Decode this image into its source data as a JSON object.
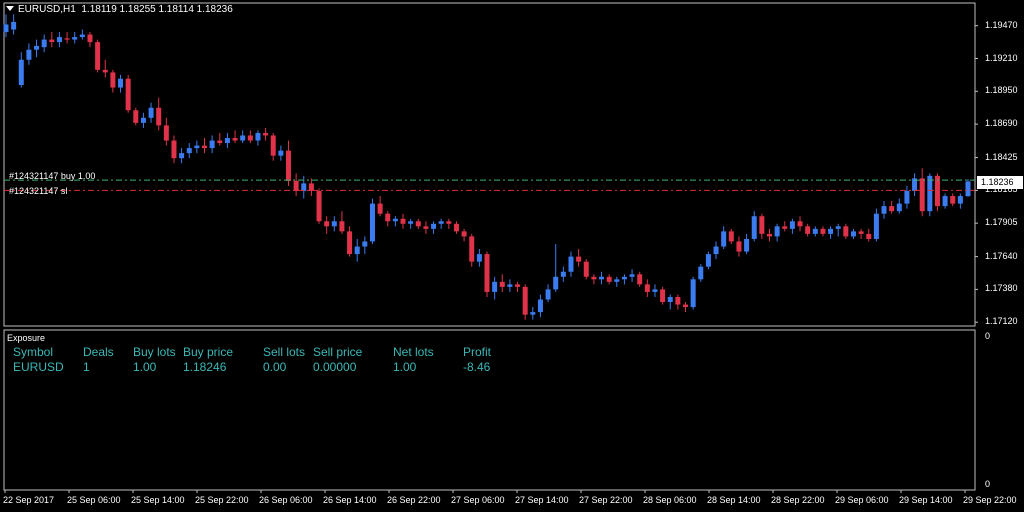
{
  "header": {
    "symbol_tf": "EURUSD,H1",
    "ohlc": "1.18119 1.18255 1.18114 1.18236"
  },
  "trade_lines": {
    "buy_label": "#124321147 buy 1.00",
    "sl_label": "#124321147 sl",
    "buy_price": 1.18246,
    "sl_price": 1.18165,
    "buy_color": "#3cb371",
    "sl_color": "#e03030"
  },
  "current_price": "1.18236",
  "colors": {
    "bull": "#3b7cf0",
    "bear": "#e0334a",
    "frame": "#c0c0c0"
  },
  "chart_data": {
    "type": "candlestick",
    "y_ticks": [
      "1.19470",
      "1.19210",
      "1.18950",
      "1.18690",
      "1.18425",
      "1.18165",
      "1.17905",
      "1.17640",
      "1.17380",
      "1.17120"
    ],
    "ylim": [
      1.1709,
      1.1965
    ],
    "x_ticks": [
      "22 Sep 2017",
      "25 Sep 06:00",
      "25 Sep 14:00",
      "25 Sep 22:00",
      "26 Sep 06:00",
      "26 Sep 14:00",
      "26 Sep 22:00",
      "27 Sep 06:00",
      "27 Sep 14:00",
      "27 Sep 22:00",
      "28 Sep 06:00",
      "28 Sep 14:00",
      "28 Sep 22:00",
      "29 Sep 06:00",
      "29 Sep 14:00",
      "29 Sep 22:00"
    ],
    "ohlc": [
      [
        1.1942,
        1.1956,
        1.1938,
        1.1948
      ],
      [
        1.1944,
        1.1956,
        1.194,
        1.195
      ],
      [
        1.19,
        1.1926,
        1.1898,
        1.192
      ],
      [
        1.192,
        1.1933,
        1.1916,
        1.1928
      ],
      [
        1.1928,
        1.1936,
        1.1922,
        1.1931
      ],
      [
        1.193,
        1.194,
        1.1926,
        1.1936
      ],
      [
        1.1936,
        1.1942,
        1.193,
        1.1934
      ],
      [
        1.1934,
        1.1942,
        1.193,
        1.1938
      ],
      [
        1.1937,
        1.1942,
        1.1933,
        1.1936
      ],
      [
        1.1936,
        1.1942,
        1.1933,
        1.1938
      ],
      [
        1.1938,
        1.1944,
        1.1936,
        1.194
      ],
      [
        1.194,
        1.1942,
        1.193,
        1.1934
      ],
      [
        1.1934,
        1.1936,
        1.191,
        1.1912
      ],
      [
        1.1912,
        1.192,
        1.1906,
        1.191
      ],
      [
        1.191,
        1.1912,
        1.1894,
        1.1898
      ],
      [
        1.1898,
        1.1908,
        1.1894,
        1.1905
      ],
      [
        1.1905,
        1.1908,
        1.1878,
        1.188
      ],
      [
        1.188,
        1.1882,
        1.1868,
        1.187
      ],
      [
        1.187,
        1.1878,
        1.1866,
        1.1874
      ],
      [
        1.1874,
        1.1886,
        1.187,
        1.1882
      ],
      [
        1.1882,
        1.189,
        1.1864,
        1.1868
      ],
      [
        1.1868,
        1.1874,
        1.1852,
        1.1856
      ],
      [
        1.1856,
        1.186,
        1.1838,
        1.1842
      ],
      [
        1.1842,
        1.185,
        1.1838,
        1.1846
      ],
      [
        1.1846,
        1.1854,
        1.1842,
        1.185
      ],
      [
        1.185,
        1.1856,
        1.1846,
        1.1852
      ],
      [
        1.1852,
        1.1858,
        1.1846,
        1.185
      ],
      [
        1.185,
        1.186,
        1.1846,
        1.1856
      ],
      [
        1.1856,
        1.1862,
        1.1852,
        1.1854
      ],
      [
        1.1854,
        1.1862,
        1.185,
        1.1858
      ],
      [
        1.1858,
        1.1864,
        1.1854,
        1.1856
      ],
      [
        1.1856,
        1.1864,
        1.1854,
        1.186
      ],
      [
        1.186,
        1.1864,
        1.1854,
        1.1856
      ],
      [
        1.1856,
        1.1864,
        1.1852,
        1.1862
      ],
      [
        1.1862,
        1.1866,
        1.1856,
        1.186
      ],
      [
        1.186,
        1.1862,
        1.184,
        1.1844
      ],
      [
        1.1844,
        1.1852,
        1.184,
        1.1848
      ],
      [
        1.1848,
        1.1856,
        1.182,
        1.1824
      ],
      [
        1.1824,
        1.183,
        1.1812,
        1.1816
      ],
      [
        1.1816,
        1.1828,
        1.181,
        1.1822
      ],
      [
        1.1822,
        1.1826,
        1.1812,
        1.1816
      ],
      [
        1.1816,
        1.1818,
        1.179,
        1.1792
      ],
      [
        1.1792,
        1.1796,
        1.1782,
        1.1788
      ],
      [
        1.1788,
        1.1796,
        1.1784,
        1.1792
      ],
      [
        1.1792,
        1.18,
        1.1782,
        1.1784
      ],
      [
        1.1784,
        1.1788,
        1.1764,
        1.1766
      ],
      [
        1.1766,
        1.1778,
        1.176,
        1.1772
      ],
      [
        1.1772,
        1.178,
        1.1766,
        1.1776
      ],
      [
        1.1776,
        1.181,
        1.1774,
        1.1806
      ],
      [
        1.1806,
        1.1812,
        1.1796,
        1.1798
      ],
      [
        1.1798,
        1.18,
        1.1788,
        1.1792
      ],
      [
        1.1792,
        1.1796,
        1.1788,
        1.1794
      ],
      [
        1.1794,
        1.1798,
        1.1786,
        1.179
      ],
      [
        1.179,
        1.1794,
        1.1786,
        1.1792
      ],
      [
        1.1792,
        1.1794,
        1.1786,
        1.1788
      ],
      [
        1.1788,
        1.1792,
        1.1782,
        1.1786
      ],
      [
        1.1786,
        1.1792,
        1.1782,
        1.179
      ],
      [
        1.179,
        1.1794,
        1.1786,
        1.1792
      ],
      [
        1.1792,
        1.1794,
        1.1786,
        1.179
      ],
      [
        1.179,
        1.1792,
        1.1782,
        1.1784
      ],
      [
        1.1784,
        1.1786,
        1.1776,
        1.178
      ],
      [
        1.178,
        1.1782,
        1.1756,
        1.176
      ],
      [
        1.176,
        1.177,
        1.1756,
        1.1766
      ],
      [
        1.1766,
        1.1768,
        1.1732,
        1.1736
      ],
      [
        1.1736,
        1.1748,
        1.173,
        1.1744
      ],
      [
        1.1744,
        1.175,
        1.1736,
        1.174
      ],
      [
        1.174,
        1.1746,
        1.1736,
        1.1742
      ],
      [
        1.1742,
        1.1744,
        1.1736,
        1.174
      ],
      [
        1.174,
        1.1742,
        1.1714,
        1.1718
      ],
      [
        1.1718,
        1.1724,
        1.1714,
        1.172
      ],
      [
        1.172,
        1.1734,
        1.1716,
        1.173
      ],
      [
        1.173,
        1.1742,
        1.1728,
        1.1738
      ],
      [
        1.1738,
        1.1774,
        1.1736,
        1.1748
      ],
      [
        1.1748,
        1.1756,
        1.1744,
        1.1752
      ],
      [
        1.1752,
        1.1768,
        1.1748,
        1.1764
      ],
      [
        1.1764,
        1.177,
        1.1756,
        1.176
      ],
      [
        1.176,
        1.1762,
        1.1746,
        1.1748
      ],
      [
        1.1748,
        1.175,
        1.1742,
        1.1746
      ],
      [
        1.1746,
        1.1752,
        1.1742,
        1.1748
      ],
      [
        1.1748,
        1.175,
        1.1742,
        1.1744
      ],
      [
        1.1744,
        1.1748,
        1.174,
        1.1746
      ],
      [
        1.1746,
        1.175,
        1.1742,
        1.1748
      ],
      [
        1.1748,
        1.1754,
        1.1744,
        1.175
      ],
      [
        1.175,
        1.1752,
        1.174,
        1.1742
      ],
      [
        1.1742,
        1.1746,
        1.1732,
        1.1736
      ],
      [
        1.1736,
        1.1742,
        1.1732,
        1.1738
      ],
      [
        1.1738,
        1.174,
        1.1726,
        1.1728
      ],
      [
        1.1728,
        1.1734,
        1.1722,
        1.1732
      ],
      [
        1.1732,
        1.1734,
        1.1722,
        1.1726
      ],
      [
        1.1726,
        1.1728,
        1.172,
        1.1724
      ],
      [
        1.1724,
        1.1748,
        1.1722,
        1.1746
      ],
      [
        1.1746,
        1.1758,
        1.1744,
        1.1756
      ],
      [
        1.1756,
        1.1768,
        1.1754,
        1.1766
      ],
      [
        1.1766,
        1.1776,
        1.1762,
        1.1772
      ],
      [
        1.1772,
        1.1788,
        1.177,
        1.1784
      ],
      [
        1.1784,
        1.1786,
        1.1774,
        1.1776
      ],
      [
        1.1776,
        1.178,
        1.1764,
        1.1768
      ],
      [
        1.1768,
        1.1782,
        1.1766,
        1.1778
      ],
      [
        1.1778,
        1.18,
        1.1776,
        1.1796
      ],
      [
        1.1796,
        1.1798,
        1.1778,
        1.1782
      ],
      [
        1.1782,
        1.1786,
        1.1776,
        1.178
      ],
      [
        1.178,
        1.179,
        1.1776,
        1.1788
      ],
      [
        1.1788,
        1.1792,
        1.1784,
        1.1786
      ],
      [
        1.1786,
        1.1794,
        1.1782,
        1.1792
      ],
      [
        1.1792,
        1.1796,
        1.1784,
        1.1788
      ],
      [
        1.1788,
        1.179,
        1.178,
        1.1782
      ],
      [
        1.1782,
        1.1788,
        1.178,
        1.1786
      ],
      [
        1.1786,
        1.1788,
        1.178,
        1.1782
      ],
      [
        1.1782,
        1.1788,
        1.1778,
        1.1786
      ],
      [
        1.1786,
        1.179,
        1.178,
        1.1788
      ],
      [
        1.1788,
        1.179,
        1.1778,
        1.178
      ],
      [
        1.178,
        1.1786,
        1.1778,
        1.1784
      ],
      [
        1.1784,
        1.1786,
        1.1778,
        1.1782
      ],
      [
        1.1782,
        1.1786,
        1.1776,
        1.1778
      ],
      [
        1.1778,
        1.1802,
        1.1776,
        1.1798
      ],
      [
        1.1798,
        1.1808,
        1.1794,
        1.1804
      ],
      [
        1.1804,
        1.1808,
        1.1798,
        1.18
      ],
      [
        1.18,
        1.181,
        1.1798,
        1.1806
      ],
      [
        1.1806,
        1.182,
        1.1802,
        1.1816
      ],
      [
        1.1816,
        1.183,
        1.1812,
        1.1826
      ],
      [
        1.1826,
        1.1834,
        1.1796,
        1.18
      ],
      [
        1.18,
        1.183,
        1.1796,
        1.1828
      ],
      [
        1.1828,
        1.183,
        1.18,
        1.1804
      ],
      [
        1.1804,
        1.1814,
        1.1802,
        1.1812
      ],
      [
        1.1812,
        1.1814,
        1.1804,
        1.1806
      ],
      [
        1.1806,
        1.1814,
        1.1802,
        1.1812
      ],
      [
        1.18119,
        1.18255,
        1.18114,
        1.18236
      ]
    ]
  },
  "exposure": {
    "title": "Exposure",
    "headers": [
      "Symbol",
      "Deals",
      "Buy lots",
      "Buy price",
      "Sell lots",
      "Sell price",
      "Net lots",
      "Profit"
    ],
    "row": [
      "EURUSD",
      "1",
      "1.00",
      "1.18246",
      "0.00",
      "0.00000",
      "1.00",
      "-8.46"
    ],
    "scale_top": "0",
    "scale_bottom": "0"
  }
}
